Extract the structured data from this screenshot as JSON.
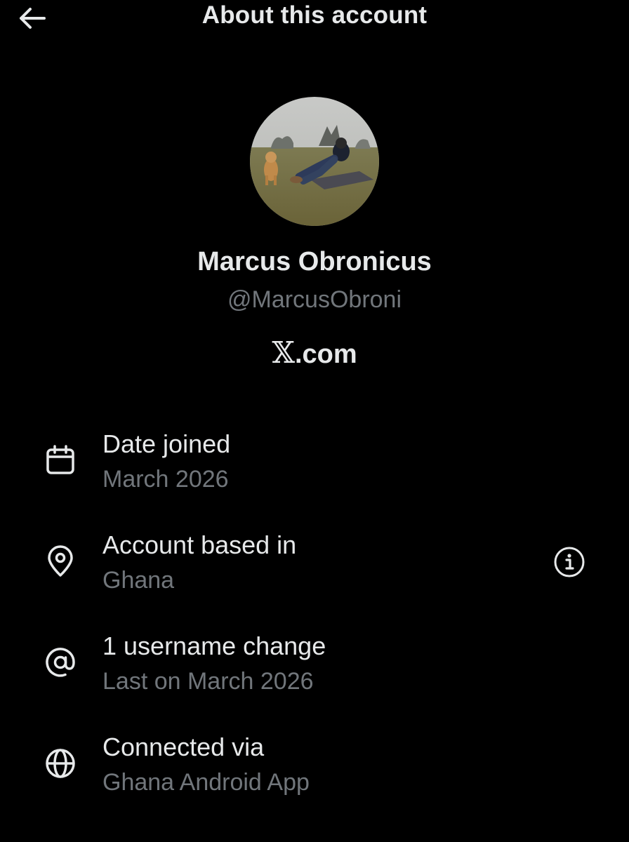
{
  "header": {
    "back_icon": "arrow-left-icon",
    "title": "About this account"
  },
  "profile": {
    "avatar_description_icon": "profile-photo",
    "name": "Marcus Obronicus",
    "handle": "@MarcusObroni",
    "platform_mark": "𝕏",
    "platform_suffix": ".com"
  },
  "details": [
    {
      "icon": "calendar-icon",
      "label": "Date joined",
      "value": "March 2026"
    },
    {
      "icon": "location-pin-icon",
      "label": "Account based in",
      "value": "Ghana",
      "info_icon": "info-icon"
    },
    {
      "icon": "at-sign-icon",
      "label": "1 username change",
      "value": "Last on March 2026"
    },
    {
      "icon": "globe-icon",
      "label": "Connected via",
      "value": "Ghana Android App"
    }
  ],
  "colors": {
    "background": "#000000",
    "primary_text": "#e7e9ea",
    "secondary_text": "#71767b"
  }
}
